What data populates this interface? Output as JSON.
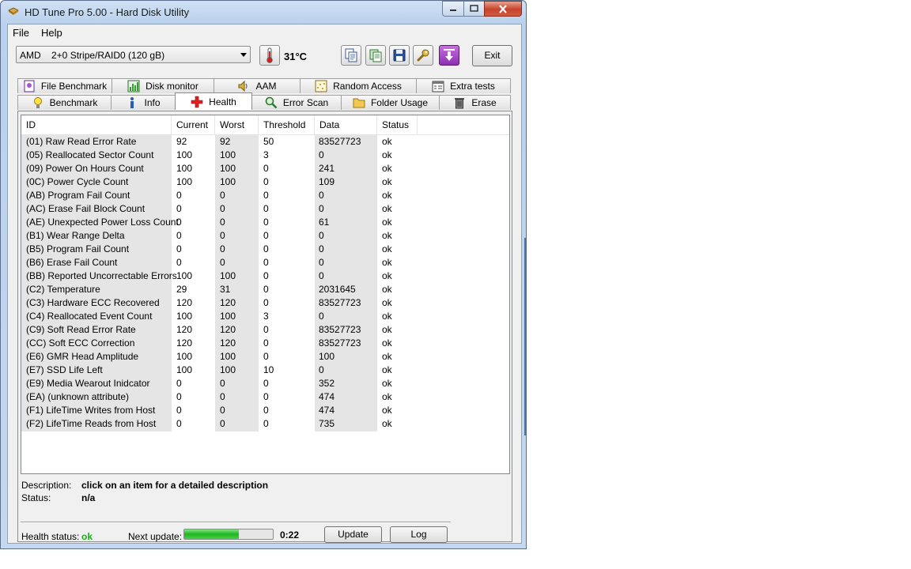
{
  "window": {
    "title": "HD Tune Pro 5.00 - Hard Disk Utility"
  },
  "menu": {
    "file": "File",
    "help": "Help"
  },
  "toolbar": {
    "drive": "AMD    2+0 Stripe/RAID0 (120 gB)",
    "temperature": "31°C",
    "exit_label": "Exit"
  },
  "tabs_top": [
    "File Benchmark",
    "Disk monitor",
    "AAM",
    "Random Access",
    "Extra tests"
  ],
  "tabs_bottom": [
    "Benchmark",
    "Info",
    "Health",
    "Error Scan",
    "Folder Usage",
    "Erase"
  ],
  "active_tab": "Health",
  "table": {
    "columns": [
      "ID",
      "Current",
      "Worst",
      "Threshold",
      "Data",
      "Status"
    ],
    "rows": [
      [
        "(01) Raw Read Error Rate",
        "92",
        "92",
        "50",
        "83527723",
        "ok"
      ],
      [
        "(05) Reallocated Sector Count",
        "100",
        "100",
        "3",
        "0",
        "ok"
      ],
      [
        "(09) Power On Hours Count",
        "100",
        "100",
        "0",
        "241",
        "ok"
      ],
      [
        "(0C) Power Cycle Count",
        "100",
        "100",
        "0",
        "109",
        "ok"
      ],
      [
        "(AB) Program Fail Count",
        "0",
        "0",
        "0",
        "0",
        "ok"
      ],
      [
        "(AC) Erase Fail Block Count",
        "0",
        "0",
        "0",
        "0",
        "ok"
      ],
      [
        "(AE) Unexpected Power Loss Count",
        "0",
        "0",
        "0",
        "61",
        "ok"
      ],
      [
        "(B1) Wear Range Delta",
        "0",
        "0",
        "0",
        "0",
        "ok"
      ],
      [
        "(B5) Program Fail Count",
        "0",
        "0",
        "0",
        "0",
        "ok"
      ],
      [
        "(B6) Erase Fail Count",
        "0",
        "0",
        "0",
        "0",
        "ok"
      ],
      [
        "(BB) Reported Uncorrectable Errors",
        "100",
        "100",
        "0",
        "0",
        "ok"
      ],
      [
        "(C2) Temperature",
        "29",
        "31",
        "0",
        "2031645",
        "ok"
      ],
      [
        "(C3) Hardware ECC Recovered",
        "120",
        "120",
        "0",
        "83527723",
        "ok"
      ],
      [
        "(C4) Reallocated Event Count",
        "100",
        "100",
        "3",
        "0",
        "ok"
      ],
      [
        "(C9) Soft Read Error Rate",
        "120",
        "120",
        "0",
        "83527723",
        "ok"
      ],
      [
        "(CC) Soft ECC Correction",
        "120",
        "120",
        "0",
        "83527723",
        "ok"
      ],
      [
        "(E6) GMR Head Amplitude",
        "100",
        "100",
        "0",
        "100",
        "ok"
      ],
      [
        "(E7) SSD Life Left",
        "100",
        "100",
        "10",
        "0",
        "ok"
      ],
      [
        "(E9) Media Wearout Inidcator",
        "0",
        "0",
        "0",
        "352",
        "ok"
      ],
      [
        "(EA) (unknown attribute)",
        "0",
        "0",
        "0",
        "474",
        "ok"
      ],
      [
        "(F1) LifeTime Writes from Host",
        "0",
        "0",
        "0",
        "474",
        "ok"
      ],
      [
        "(F2) LifeTime Reads from Host",
        "0",
        "0",
        "0",
        "735",
        "ok"
      ]
    ]
  },
  "details": {
    "description_label": "Description:",
    "description_value": "click on an item for a detailed description",
    "status_label": "Status:",
    "status_value": "n/a"
  },
  "footer": {
    "health_label": "Health status:",
    "health_value": "ok",
    "next_update_label": "Next update:",
    "progress": 0.62,
    "countdown": "0:22",
    "update_label": "Update",
    "log_label": "Log"
  },
  "colors": {
    "ok_green": "#1aaf1a",
    "progress_green": "#21b421",
    "window_frame": "#b9d1ec"
  }
}
